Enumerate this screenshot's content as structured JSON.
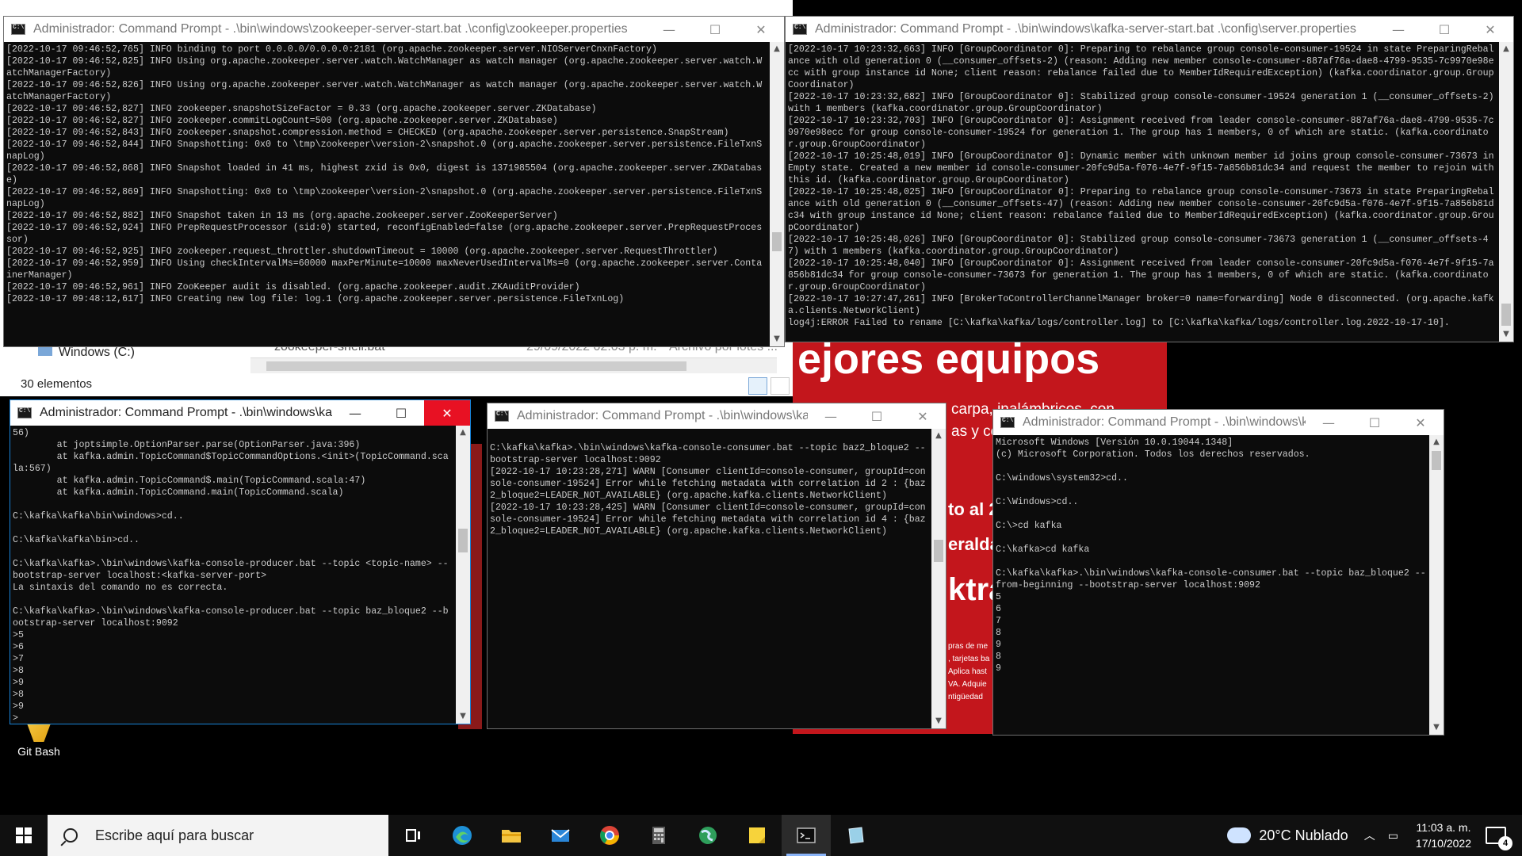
{
  "explorer": {
    "drive_label": "Windows (C:)",
    "file_name": "zookeeper-shell.bat",
    "file_date": "29/09/2022 02:03 p. m.",
    "file_type": "Archivo por lotes ...",
    "item_count": "30 elementos"
  },
  "advert": {
    "headline": "ejores equipos",
    "line1": "carpa, inalámbricos, con",
    "line2": "as y cel",
    "line3": "to al 2",
    "line4": "eralda",
    "line5": "ktra",
    "small1": "pras de me",
    "small2": ", tarjetas ba",
    "small3": "Aplica hast",
    "small4": "VA. Adquie",
    "small5": "ntigüedad"
  },
  "desktop": {
    "git_bash_label": "Git Bash"
  },
  "windows": {
    "zookeeper": {
      "title": "Administrador: Command Prompt - .\\bin\\windows\\zookeeper-server-start.bat .\\config\\zookeeper.properties",
      "output": "[2022-10-17 09:46:52,765] INFO binding to port 0.0.0.0/0.0.0.0:2181 (org.apache.zookeeper.server.NIOServerCnxnFactory)\n[2022-10-17 09:46:52,825] INFO Using org.apache.zookeeper.server.watch.WatchManager as watch manager (org.apache.zookeeper.server.watch.WatchManagerFactory)\n[2022-10-17 09:46:52,826] INFO Using org.apache.zookeeper.server.watch.WatchManager as watch manager (org.apache.zookeeper.server.watch.WatchManagerFactory)\n[2022-10-17 09:46:52,827] INFO zookeeper.snapshotSizeFactor = 0.33 (org.apache.zookeeper.server.ZKDatabase)\n[2022-10-17 09:46:52,827] INFO zookeeper.commitLogCount=500 (org.apache.zookeeper.server.ZKDatabase)\n[2022-10-17 09:46:52,843] INFO zookeeper.snapshot.compression.method = CHECKED (org.apache.zookeeper.server.persistence.SnapStream)\n[2022-10-17 09:46:52,844] INFO Snapshotting: 0x0 to \\tmp\\zookeeper\\version-2\\snapshot.0 (org.apache.zookeeper.server.persistence.FileTxnSnapLog)\n[2022-10-17 09:46:52,868] INFO Snapshot loaded in 41 ms, highest zxid is 0x0, digest is 1371985504 (org.apache.zookeeper.server.ZKDatabase)\n[2022-10-17 09:46:52,869] INFO Snapshotting: 0x0 to \\tmp\\zookeeper\\version-2\\snapshot.0 (org.apache.zookeeper.server.persistence.FileTxnSnapLog)\n[2022-10-17 09:46:52,882] INFO Snapshot taken in 13 ms (org.apache.zookeeper.server.ZooKeeperServer)\n[2022-10-17 09:46:52,924] INFO PrepRequestProcessor (sid:0) started, reconfigEnabled=false (org.apache.zookeeper.server.PrepRequestProcessor)\n[2022-10-17 09:46:52,925] INFO zookeeper.request_throttler.shutdownTimeout = 10000 (org.apache.zookeeper.server.RequestThrottler)\n[2022-10-17 09:46:52,959] INFO Using checkIntervalMs=60000 maxPerMinute=10000 maxNeverUsedIntervalMs=0 (org.apache.zookeeper.server.ContainerManager)\n[2022-10-17 09:46:52,961] INFO ZooKeeper audit is disabled. (org.apache.zookeeper.audit.ZKAuditProvider)\n[2022-10-17 09:48:12,617] INFO Creating new log file: log.1 (org.apache.zookeeper.server.persistence.FileTxnLog)"
    },
    "kafka_server": {
      "title": "Administrador: Command Prompt - .\\bin\\windows\\kafka-server-start.bat .\\config\\server.properties",
      "output": "[2022-10-17 10:23:32,663] INFO [GroupCoordinator 0]: Preparing to rebalance group console-consumer-19524 in state PreparingRebalance with old generation 0 (__consumer_offsets-2) (reason: Adding new member console-consumer-887af76a-dae8-4799-9535-7c9970e98ecc with group instance id None; client reason: rebalance failed due to MemberIdRequiredException) (kafka.coordinator.group.GroupCoordinator)\n[2022-10-17 10:23:32,682] INFO [GroupCoordinator 0]: Stabilized group console-consumer-19524 generation 1 (__consumer_offsets-2) with 1 members (kafka.coordinator.group.GroupCoordinator)\n[2022-10-17 10:23:32,703] INFO [GroupCoordinator 0]: Assignment received from leader console-consumer-887af76a-dae8-4799-9535-7c9970e98ecc for group console-consumer-19524 for generation 1. The group has 1 members, 0 of which are static. (kafka.coordinator.group.GroupCoordinator)\n[2022-10-17 10:25:48,019] INFO [GroupCoordinator 0]: Dynamic member with unknown member id joins group console-consumer-73673 in Empty state. Created a new member id console-consumer-20fc9d5a-f076-4e7f-9f15-7a856b81dc34 and request the member to rejoin with this id. (kafka.coordinator.group.GroupCoordinator)\n[2022-10-17 10:25:48,025] INFO [GroupCoordinator 0]: Preparing to rebalance group console-consumer-73673 in state PreparingRebalance with old generation 0 (__consumer_offsets-47) (reason: Adding new member console-consumer-20fc9d5a-f076-4e7f-9f15-7a856b81dc34 with group instance id None; client reason: rebalance failed due to MemberIdRequiredException) (kafka.coordinator.group.GroupCoordinator)\n[2022-10-17 10:25:48,026] INFO [GroupCoordinator 0]: Stabilized group console-consumer-73673 generation 1 (__consumer_offsets-47) with 1 members (kafka.coordinator.group.GroupCoordinator)\n[2022-10-17 10:25:48,040] INFO [GroupCoordinator 0]: Assignment received from leader console-consumer-20fc9d5a-f076-4e7f-9f15-7a856b81dc34 for group console-consumer-73673 for generation 1. The group has 1 members, 0 of which are static. (kafka.coordinator.group.GroupCoordinator)\n[2022-10-17 10:27:47,261] INFO [BrokerToControllerChannelManager broker=0 name=forwarding] Node 0 disconnected. (org.apache.kafka.clients.NetworkClient)\nlog4j:ERROR Failed to rename [C:\\kafka\\kafka/logs/controller.log] to [C:\\kafka\\kafka/logs/controller.log.2022-10-17-10]."
    },
    "producer": {
      "title": "Administrador: Command Prompt - .\\bin\\windows\\kaf...",
      "output": "56)\n        at joptsimple.OptionParser.parse(OptionParser.java:396)\n        at kafka.admin.TopicCommand$TopicCommandOptions.<init>(TopicCommand.scala:567)\n        at kafka.admin.TopicCommand$.main(TopicCommand.scala:47)\n        at kafka.admin.TopicCommand.main(TopicCommand.scala)\n\nC:\\kafka\\kafka\\bin\\windows>cd..\n\nC:\\kafka\\kafka\\bin>cd..\n\nC:\\kafka\\kafka>.\\bin\\windows\\kafka-console-producer.bat --topic <topic-name> --bootstrap-server localhost:<kafka-server-port>\nLa sintaxis del comando no es correcta.\n\nC:\\kafka\\kafka>.\\bin\\windows\\kafka-console-producer.bat --topic baz_bloque2 --bootstrap-server localhost:9092\n>5\n>6\n>7\n>8\n>9\n>8\n>9\n>"
    },
    "consumer1": {
      "title": "Administrador: Command Prompt - .\\bin\\windows\\kaf...",
      "output": "\nC:\\kafka\\kafka>.\\bin\\windows\\kafka-console-consumer.bat --topic baz2_bloque2 --bootstrap-server localhost:9092\n[2022-10-17 10:23:28,271] WARN [Consumer clientId=console-consumer, groupId=console-consumer-19524] Error while fetching metadata with correlation id 2 : {baz2_bloque2=LEADER_NOT_AVAILABLE} (org.apache.kafka.clients.NetworkClient)\n[2022-10-17 10:23:28,425] WARN [Consumer clientId=console-consumer, groupId=console-consumer-19524] Error while fetching metadata with correlation id 4 : {baz2_bloque2=LEADER_NOT_AVAILABLE} (org.apache.kafka.clients.NetworkClient)"
    },
    "consumer2": {
      "title": "Administrador: Command Prompt - .\\bin\\windows\\kaf...",
      "output": "Microsoft Windows [Versión 10.0.19044.1348]\n(c) Microsoft Corporation. Todos los derechos reservados.\n\nC:\\windows\\system32>cd..\n\nC:\\Windows>cd..\n\nC:\\>cd kafka\n\nC:\\kafka>cd kafka\n\nC:\\kafka\\kafka>.\\bin\\windows\\kafka-console-consumer.bat --topic baz_bloque2 --from-beginning --bootstrap-server localhost:9092\n5\n6\n7\n8\n9\n8\n9"
    }
  },
  "window_controls": {
    "minimize": "—",
    "maximize": "☐",
    "close": "✕"
  },
  "taskbar": {
    "search_placeholder": "Escribe aquí para buscar",
    "weather": "20°C  Nublado",
    "time": "11:03 a. m.",
    "date": "17/10/2022",
    "notification_count": "4",
    "icons": [
      "task-view",
      "edge",
      "file-explorer",
      "mail",
      "chrome",
      "calculator",
      "browser-globe",
      "sticky-notes",
      "command-prompt",
      "app-window"
    ]
  },
  "colors": {
    "console_bg": "#0c0c0c",
    "console_text": "#cccccc",
    "close_hover": "#e81123",
    "taskbar": "#101010"
  }
}
